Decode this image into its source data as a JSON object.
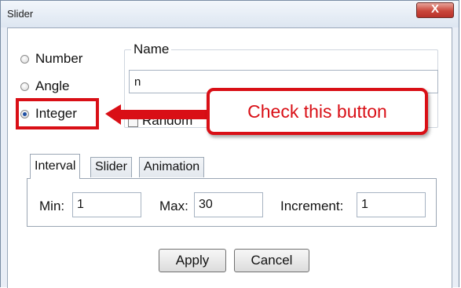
{
  "window": {
    "title": "Slider",
    "close_label": "X"
  },
  "type_options": [
    {
      "label": "Number",
      "checked": false
    },
    {
      "label": "Angle",
      "checked": false
    },
    {
      "label": "Integer",
      "checked": true
    }
  ],
  "name_group": {
    "legend": "Name",
    "value": "n"
  },
  "random": {
    "label": "Random",
    "checked": false
  },
  "annotation": {
    "text": "Check this button",
    "color": "#d90f16"
  },
  "tabs": [
    {
      "label": "Interval",
      "active": true
    },
    {
      "label": "Slider",
      "active": false
    },
    {
      "label": "Animation",
      "active": false
    }
  ],
  "interval": {
    "min_label": "Min:",
    "min_value": "1",
    "max_label": "Max:",
    "max_value": "30",
    "increment_label": "Increment:",
    "increment_value": "1"
  },
  "buttons": {
    "apply": "Apply",
    "cancel": "Cancel"
  }
}
